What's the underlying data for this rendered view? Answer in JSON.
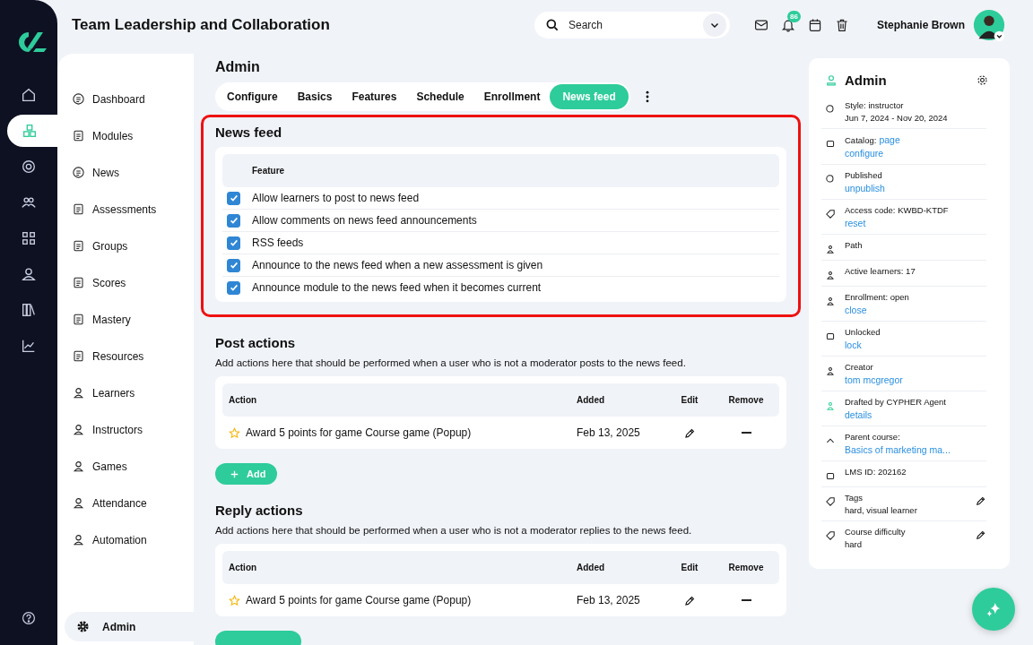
{
  "header": {
    "title": "Team Leadership and Collaboration",
    "search": {
      "placeholder": "Search"
    },
    "notification_count": "86",
    "user_name": "Stephanie Brown"
  },
  "rail": {
    "items": [
      {
        "selected": false
      },
      {
        "selected": true
      },
      {
        "selected": false
      },
      {
        "selected": false
      },
      {
        "selected": false
      },
      {
        "selected": false
      },
      {
        "selected": false
      },
      {
        "selected": false
      }
    ]
  },
  "nav": {
    "items": [
      {
        "label": "Dashboard",
        "selected": false
      },
      {
        "label": "Modules",
        "selected": false
      },
      {
        "label": "News",
        "selected": false
      },
      {
        "label": "Assessments",
        "selected": false
      },
      {
        "label": "Groups",
        "selected": false
      },
      {
        "label": "Scores",
        "selected": false
      },
      {
        "label": "Mastery",
        "selected": false
      },
      {
        "label": "Resources",
        "selected": false
      },
      {
        "label": "Learners",
        "selected": false
      },
      {
        "label": "Instructors",
        "selected": false
      },
      {
        "label": "Games",
        "selected": false
      },
      {
        "label": "Attendance",
        "selected": false
      },
      {
        "label": "Automation",
        "selected": false
      }
    ],
    "admin": {
      "label": "Admin",
      "selected": true
    }
  },
  "page": {
    "heading": "Admin",
    "tabs": [
      {
        "label": "Configure",
        "selected": false
      },
      {
        "label": "Basics",
        "selected": false
      },
      {
        "label": "Features",
        "selected": false
      },
      {
        "label": "Schedule",
        "selected": false
      },
      {
        "label": "Enrollment",
        "selected": false
      },
      {
        "label": "News feed",
        "selected": true
      }
    ],
    "news_feed": {
      "title": "News feed",
      "highlighted": true,
      "column": "Feature",
      "features": [
        {
          "label": "Allow learners to post to news feed",
          "checked": true
        },
        {
          "label": "Allow comments on news feed announcements",
          "checked": true
        },
        {
          "label": "RSS feeds",
          "checked": true
        },
        {
          "label": "Announce to the news feed when a new assessment is given",
          "checked": true
        },
        {
          "label": "Announce module to the news feed when it becomes current",
          "checked": true
        }
      ]
    },
    "post_actions": {
      "title": "Post actions",
      "description": "Add actions here that should be performed when a user who is not a moderator posts to the news feed.",
      "columns": [
        "Action",
        "Added",
        "Edit",
        "Remove"
      ],
      "rows": [
        {
          "action": "Award 5 points for game Course game (Popup)",
          "added": "Feb 13, 2025"
        }
      ],
      "add_label": "Add"
    },
    "reply_actions": {
      "title": "Reply actions",
      "description": "Add actions here that should be performed when a user who is not a moderator replies to the news feed.",
      "columns": [
        "Action",
        "Added",
        "Edit",
        "Remove"
      ],
      "rows": [
        {
          "action": "Award 5 points for game Course game (Popup)",
          "added": "Feb 13, 2025"
        }
      ]
    }
  },
  "info_panel": {
    "title": "Admin",
    "rows": [
      {
        "label": "Style: instructor",
        "sub": "Jun 7, 2024 - Nov 20, 2024",
        "sub_link": false,
        "editable": false
      },
      {
        "label": "Catalog:",
        "label_link": "page",
        "sub": "configure",
        "sub_link": true,
        "editable": false
      },
      {
        "label": "Published",
        "sub": "unpublish",
        "sub_link": true,
        "editable": false
      },
      {
        "label": "Access code: KWBD-KTDF",
        "sub": "reset",
        "sub_link": true,
        "editable": false
      },
      {
        "label": "Path",
        "editable": false
      },
      {
        "label": "Active learners: 17",
        "editable": false
      },
      {
        "label": "Enrollment: open",
        "sub": "close",
        "sub_link": true,
        "editable": false
      },
      {
        "label": "Unlocked",
        "sub": "lock",
        "sub_link": true,
        "editable": false
      },
      {
        "label": "Creator",
        "sub": "tom mcgregor",
        "sub_link": true,
        "editable": false
      },
      {
        "label": "Drafted by CYPHER Agent",
        "sub": "details",
        "sub_link": true,
        "editable": false
      },
      {
        "label": "Parent course:",
        "sub": "Basics of marketing ma...",
        "sub_link": true,
        "editable": false
      },
      {
        "label": "LMS ID: 202162",
        "editable": false
      },
      {
        "label": "Tags",
        "sub": "hard, visual learner",
        "sub_link": false,
        "editable": true
      },
      {
        "label": "Course difficulty",
        "sub": "hard",
        "sub_link": false,
        "editable": true
      }
    ]
  }
}
